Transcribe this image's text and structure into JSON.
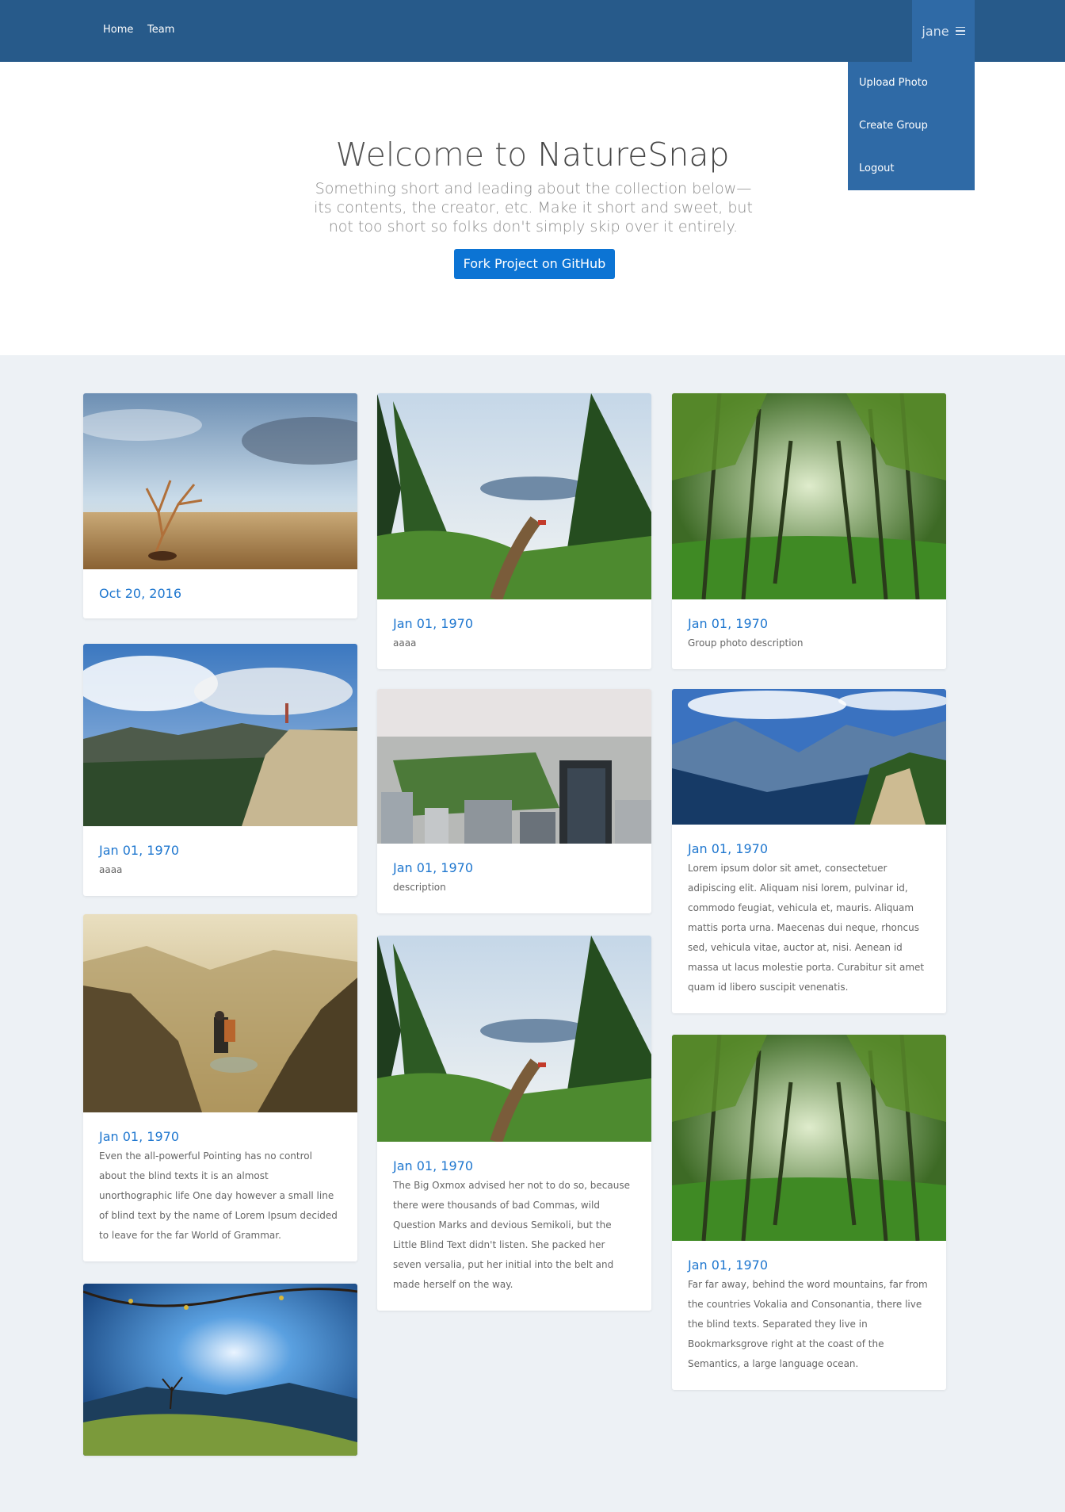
{
  "nav": {
    "links": [
      "Home",
      "Team"
    ],
    "user": "jane",
    "menu": [
      "Upload Photo",
      "Create Group",
      "Logout"
    ]
  },
  "hero": {
    "title_prefix": "Welcome to",
    "title_brand": "NatureSnap",
    "subtitle": "Something short and leading about the collection below—its contents, the creator, etc. Make it short and sweet, but not too short so folks don't simply skip over it entirely.",
    "button": "Fork Project on GitHub"
  },
  "cards": [
    {
      "date": "Oct 20, 2016",
      "description": "",
      "scene": "desert-tree"
    },
    {
      "date": "Jan 01, 1970",
      "description": "aaaa",
      "scene": "forest-lake-trail"
    },
    {
      "date": "Jan 01, 1970",
      "description": "Group photo description",
      "scene": "green-forest"
    },
    {
      "date": "Jan 01, 1970",
      "description": "aaaa",
      "scene": "mountain-cliff"
    },
    {
      "date": "Jan 01, 1970",
      "description": "description",
      "scene": "city-park"
    },
    {
      "date": "Jan 01, 1970",
      "description": "Lorem ipsum dolor sit amet, consectetuer adipiscing elit. Aliquam nisi lorem, pulvinar id, commodo feugiat, vehicula et, mauris. Aliquam mattis porta urna. Maecenas dui neque, rhoncus sed, vehicula vitae, auctor at, nisi. Aenean id massa ut lacus molestie porta. Curabitur sit amet quam id libero suscipit venenatis.",
      "scene": "mountain-valley"
    },
    {
      "date": "Jan 01, 1970",
      "description": "Even the all-powerful Pointing has no control about the blind texts it is an almost unorthographic life One day however a small line of blind text by the name of Lorem Ipsum decided to leave for the far World of Grammar.",
      "scene": "hiker-canyon"
    },
    {
      "date": "Jan 01, 1970",
      "description": "The Big Oxmox advised her not to do so, because there were thousands of bad Commas, wild Question Marks and devious Semikoli, but the Little Blind Text didn't listen. She packed her seven versalia, put her initial into the belt and made herself on the way.",
      "scene": "forest-lake-trail"
    },
    {
      "date": "Jan 01, 1970",
      "description": "Far far away, behind the word mountains, far from the countries Vokalia and Consonantia, there live the blind texts. Separated they live in Bookmarksgrove right at the coast of the Semantics, a large language ocean.",
      "scene": "green-forest"
    },
    {
      "date": "",
      "description": "",
      "scene": "tree-hill"
    }
  ]
}
